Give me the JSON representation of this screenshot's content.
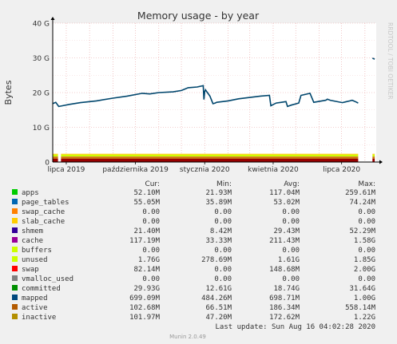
{
  "colors": {
    "background": "#f0f0f0",
    "plot_bg": "#ffffff",
    "grid": "#e8a0a0",
    "axis": "#000000",
    "text": "#333333",
    "footer": "#999999"
  },
  "chart_data": {
    "type": "area",
    "title": "Memory usage - by year",
    "ylabel": "Bytes",
    "xlabel": "",
    "side_label": "RRDTOOL / TOBI OETIKER",
    "ylim": [
      0,
      40
    ],
    "y_unit": "G",
    "yticks": [
      0,
      10,
      20,
      30,
      40
    ],
    "ytick_labels": [
      "0",
      "10 G",
      "20 G",
      "30 G",
      "40 G"
    ],
    "xlim": [
      "2019-06-13",
      "2020-08-16"
    ],
    "xticks": [
      "2019-07-01",
      "2019-10-01",
      "2020-01-01",
      "2020-04-01",
      "2020-07-01"
    ],
    "xtick_labels": [
      "lipca 2019",
      "października 2019",
      "stycznia 2020",
      "kwietnia 2020",
      "lipca 2020"
    ],
    "grid": true,
    "committed_series": {
      "name": "committed",
      "color": "#00466d",
      "x": [
        "2019-06-13",
        "2019-06-17",
        "2019-06-21",
        "2019-06-26",
        "2019-07-05",
        "2019-07-20",
        "2019-08-10",
        "2019-09-01",
        "2019-09-20",
        "2019-10-10",
        "2019-10-20",
        "2019-11-01",
        "2019-11-20",
        "2019-12-01",
        "2019-12-10",
        "2019-12-22",
        "2019-12-30",
        "2019-12-31",
        "2020-01-01",
        "2020-01-02",
        "2020-01-08",
        "2020-01-12",
        "2020-01-15",
        "2020-01-17",
        "2020-02-01",
        "2020-02-15",
        "2020-03-01",
        "2020-03-15",
        "2020-03-27",
        "2020-03-29",
        "2020-04-05",
        "2020-04-12",
        "2020-04-18",
        "2020-04-20",
        "2020-04-25",
        "2020-05-05",
        "2020-05-08",
        "2020-05-20",
        "2020-05-25",
        "2020-06-10",
        "2020-06-12",
        "2020-06-16",
        "2020-07-02",
        "2020-07-06",
        "2020-07-12",
        "2020-07-15",
        "2020-07-20",
        "2020-07-23"
      ],
      "y": [
        16.8,
        17.2,
        16.0,
        16.2,
        16.6,
        17.1,
        17.6,
        18.4,
        19.0,
        19.8,
        19.6,
        20.0,
        20.2,
        20.6,
        21.4,
        21.6,
        22.0,
        18.0,
        20.3,
        20.8,
        19.0,
        16.8,
        17.0,
        17.2,
        17.6,
        18.2,
        18.6,
        19.0,
        19.2,
        16.2,
        17.0,
        17.2,
        17.4,
        16.0,
        16.4,
        17.0,
        19.2,
        19.8,
        17.2,
        17.8,
        18.1,
        17.8,
        17.1,
        17.3,
        17.6,
        17.8,
        17.3,
        17.0
      ]
    },
    "committed_tail": {
      "x": [
        "2020-08-11",
        "2020-08-14"
      ],
      "y": [
        29.9,
        29.6
      ]
    },
    "bottom_band": {
      "segments": [
        {
          "from": "2019-06-13",
          "to": "2019-06-20"
        },
        {
          "from": "2019-06-24",
          "to": "2020-07-23"
        },
        {
          "from": "2020-08-11",
          "to": "2020-08-14"
        }
      ],
      "layers": [
        {
          "name": "inactive",
          "color": "#990000",
          "value": 1.0
        },
        {
          "name": "active",
          "color": "#cc7a00",
          "value": 0.45
        },
        {
          "name": "swap",
          "color": "#cc0000",
          "value": 0.12
        },
        {
          "name": "unused",
          "color": "#ccff00",
          "value": 0.55
        },
        {
          "name": "slab_cache",
          "color": "#ffcc00",
          "value": 0.25
        }
      ]
    },
    "legend_headers": [
      "Cur:",
      "Min:",
      "Avg:",
      "Max:"
    ],
    "legend": [
      {
        "name": "apps",
        "color": "#00cc00",
        "cur": "52.10M",
        "min": "21.93M",
        "avg": "117.04M",
        "max": "259.61M"
      },
      {
        "name": "page_tables",
        "color": "#0066b3",
        "cur": "55.05M",
        "min": "35.89M",
        "avg": "53.02M",
        "max": "74.24M"
      },
      {
        "name": "swap_cache",
        "color": "#ff8000",
        "cur": "0.00",
        "min": "0.00",
        "avg": "0.00",
        "max": "0.00"
      },
      {
        "name": "slab_cache",
        "color": "#ffcc00",
        "cur": "0.00",
        "min": "0.00",
        "avg": "0.00",
        "max": "0.00"
      },
      {
        "name": "shmem",
        "color": "#330099",
        "cur": "21.40M",
        "min": "8.42M",
        "avg": "29.43M",
        "max": "52.29M"
      },
      {
        "name": "cache",
        "color": "#990099",
        "cur": "117.19M",
        "min": "33.33M",
        "avg": "211.43M",
        "max": "1.58G"
      },
      {
        "name": "buffers",
        "color": "#ccff00",
        "cur": "0.00",
        "min": "0.00",
        "avg": "0.00",
        "max": "0.00"
      },
      {
        "name": "unused",
        "color": "#ccff00",
        "cur": "1.76G",
        "min": "278.69M",
        "avg": "1.61G",
        "max": "1.85G"
      },
      {
        "name": "swap",
        "color": "#ff0000",
        "cur": "82.14M",
        "min": "0.00",
        "avg": "148.68M",
        "max": "2.00G"
      },
      {
        "name": "vmalloc_used",
        "color": "#808080",
        "cur": "0.00",
        "min": "0.00",
        "avg": "0.00",
        "max": "0.00"
      },
      {
        "name": "committed",
        "color": "#008f00",
        "cur": "29.93G",
        "min": "12.61G",
        "avg": "18.74G",
        "max": "31.64G"
      },
      {
        "name": "mapped",
        "color": "#00487d",
        "cur": "699.09M",
        "min": "484.26M",
        "avg": "698.71M",
        "max": "1.00G"
      },
      {
        "name": "active",
        "color": "#b35a00",
        "cur": "102.68M",
        "min": "66.51M",
        "avg": "186.34M",
        "max": "558.14M"
      },
      {
        "name": "inactive",
        "color": "#b38f00",
        "cur": "101.97M",
        "min": "47.20M",
        "avg": "172.62M",
        "max": "1.22G"
      }
    ],
    "last_update": "Last update: Sun Aug 16 04:02:28 2020",
    "footer": "Munin 2.0.49"
  }
}
